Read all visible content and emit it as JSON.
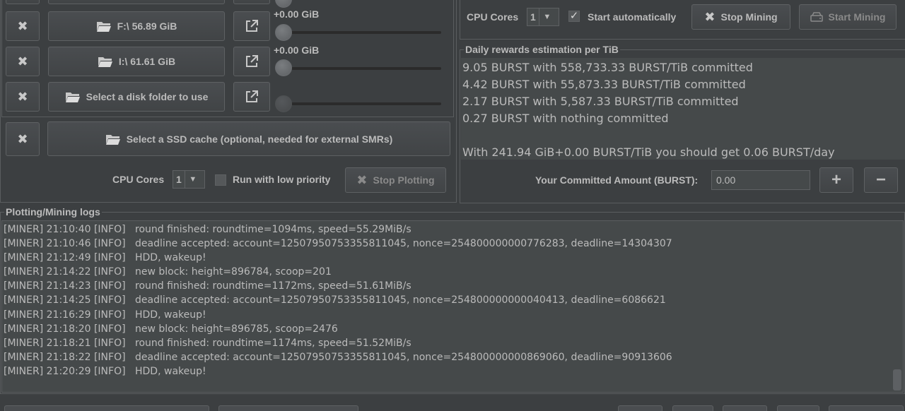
{
  "drives": [
    {
      "label": "F:\\ 56.89 GiB",
      "slider_value": "+0.00 GiB",
      "slider_fraction": 0
    },
    {
      "label": "I:\\ 61.61 GiB",
      "slider_value": "+0.00 GiB",
      "slider_fraction": 0
    },
    {
      "label": "Select a disk folder to use",
      "slider_value": "",
      "slider_fraction": 0
    }
  ],
  "ssd_cache": {
    "label": "Select a SSD cache (optional, needed for external SMRs)"
  },
  "plotting": {
    "cpu_cores_label": "CPU Cores",
    "cpu_cores_value": "1",
    "low_priority_label": "Run with low priority",
    "low_priority_checked": false,
    "stop_plotting_label": "Stop Plotting"
  },
  "mining": {
    "cpu_cores_label": "CPU Cores",
    "cpu_cores_value": "1",
    "start_auto_label": "Start automatically",
    "start_auto_checked": true,
    "stop_mining_label": "Stop Mining",
    "start_mining_label": "Start Mining"
  },
  "rewards": {
    "title": "Daily rewards estimation per TiB",
    "lines": [
      "9.05 BURST with 558,733.33 BURST/TiB committed",
      "4.42 BURST with 55,873.33 BURST/TiB committed",
      "2.17 BURST with 5,587.33 BURST/TiB committed",
      "0.27 BURST with nothing committed",
      "",
      "With 241.94 GiB+0.00 BURST/TiB you should get 0.06 BURST/day"
    ],
    "committed_label": "Your Committed Amount (BURST):",
    "committed_value": "0.00",
    "plus_label": "+",
    "minus_label": "−"
  },
  "logs": {
    "title": "Plotting/Mining logs",
    "rows": [
      {
        "prefix": "[MINER] 21:10:40 [INFO]",
        "msg": "round finished: roundtime=1094ms, speed=55.29MiB/s"
      },
      {
        "prefix": "[MINER] 21:10:46 [INFO]",
        "msg": "deadline accepted: account=12507950753355811045, nonce=254800000000776283, deadline=14304307"
      },
      {
        "prefix": "[MINER] 21:12:49 [INFO]",
        "msg": "HDD, wakeup!"
      },
      {
        "prefix": "[MINER] 21:14:22 [INFO]",
        "msg": "new block: height=896784, scoop=201"
      },
      {
        "prefix": "[MINER] 21:14:23 [INFO]",
        "msg": "round finished: roundtime=1172ms, speed=51.61MiB/s"
      },
      {
        "prefix": "[MINER] 21:14:25 [INFO]",
        "msg": "deadline accepted: account=12507950753355811045, nonce=254800000000040413, deadline=6086621"
      },
      {
        "prefix": "[MINER] 21:16:29 [INFO]",
        "msg": "HDD, wakeup!"
      },
      {
        "prefix": "[MINER] 21:18:20 [INFO]",
        "msg": "new block: height=896785, scoop=2476"
      },
      {
        "prefix": "[MINER] 21:18:21 [INFO]",
        "msg": "round finished: roundtime=1174ms, speed=51.52MiB/s"
      },
      {
        "prefix": "[MINER] 21:18:22 [INFO]",
        "msg": "deadline accepted: account=12507950753355811045, nonce=254800000000869060, deadline=90913606"
      },
      {
        "prefix": "[MINER] 21:20:29 [INFO]",
        "msg": "HDD, wakeup!"
      }
    ]
  },
  "icons": {
    "remove": "close-icon",
    "folder": "folder-icon",
    "open_external": "external-link-icon",
    "drive": "hard-drive-icon"
  }
}
